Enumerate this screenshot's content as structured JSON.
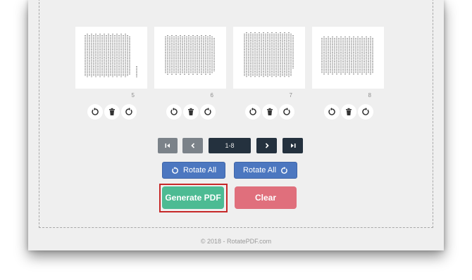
{
  "pages": [
    {
      "number": "5"
    },
    {
      "number": "6"
    },
    {
      "number": "7"
    },
    {
      "number": "8"
    }
  ],
  "page_actions": {
    "rotate_left_icon": "rotate-left-icon",
    "delete_icon": "trash-icon",
    "rotate_right_icon": "rotate-right-icon"
  },
  "pagination": {
    "range_label": "1-8",
    "first_icon": "first-page-icon",
    "prev_icon": "chevron-left-icon",
    "next_icon": "chevron-right-icon",
    "last_icon": "last-page-icon"
  },
  "rotate_all_left_label": "Rotate All",
  "rotate_all_right_label": "Rotate All",
  "generate_pdf_label": "Generate PDF",
  "clear_label": "Clear",
  "footer_text": "© 2018 - RotatePDF.com",
  "colors": {
    "rotate_button": "#4c77c0",
    "generate_button": "#4dbb93",
    "clear_button": "#e06f7c",
    "pager_light": "#7b8289",
    "pager_dark": "#24313e",
    "highlight": "#c62828"
  }
}
